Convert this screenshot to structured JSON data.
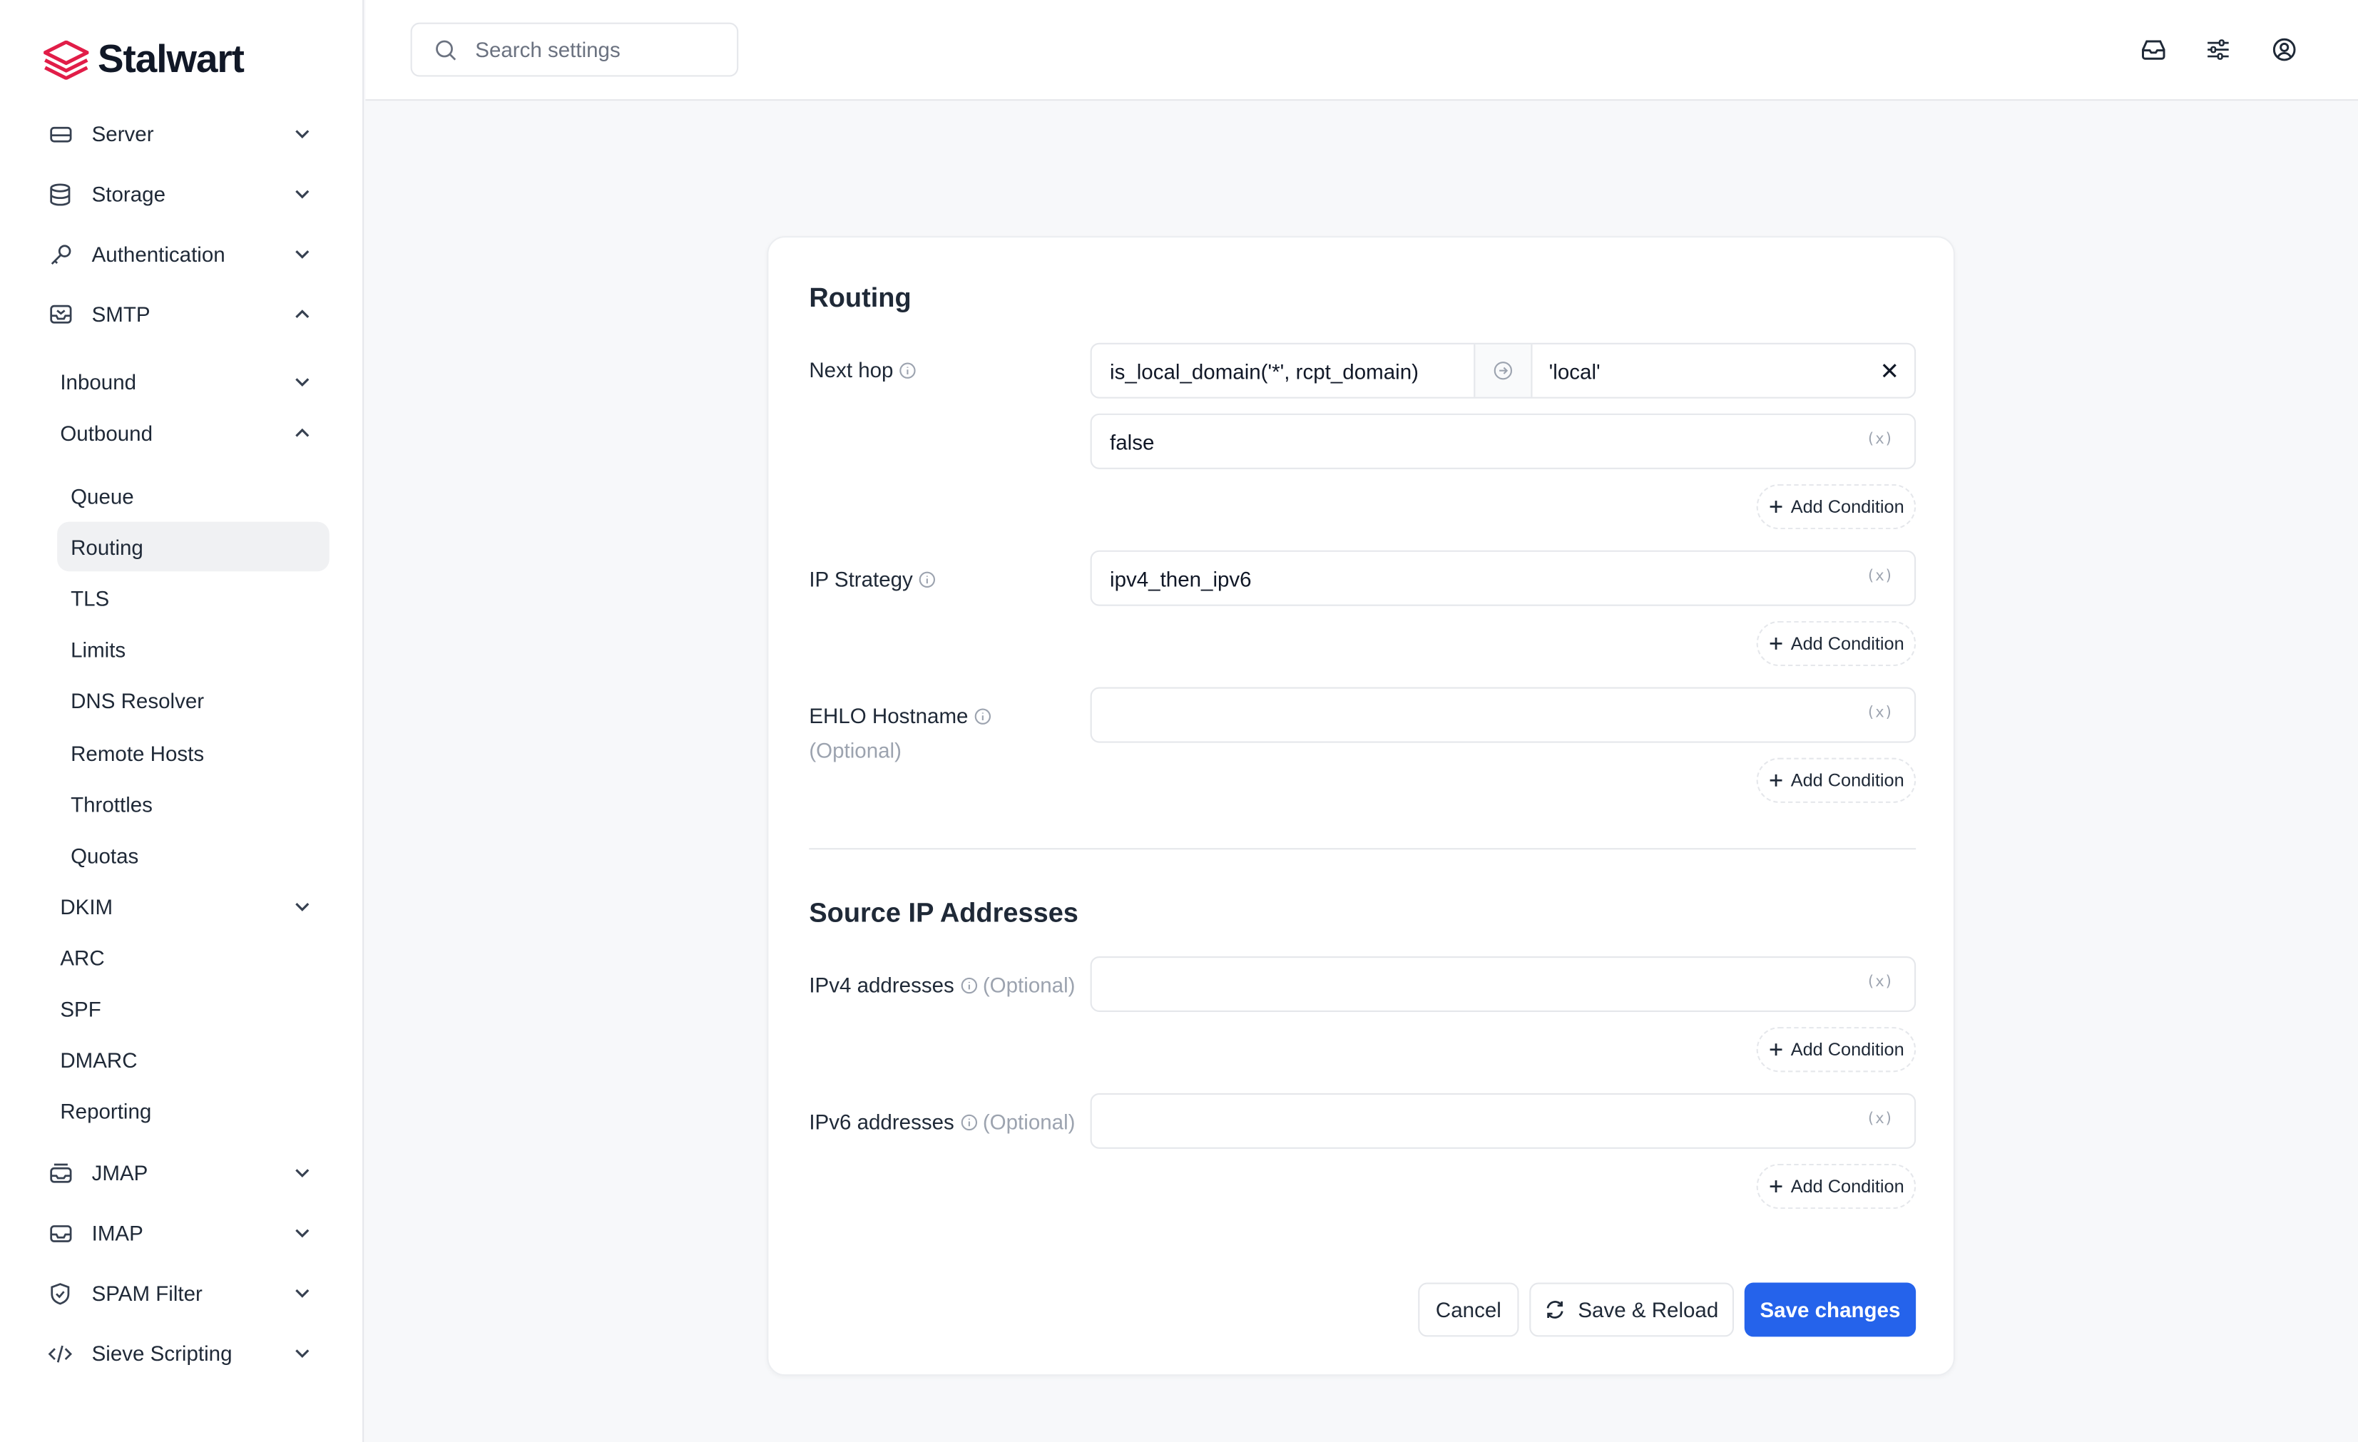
{
  "app": {
    "brand": "Stalwart",
    "brand_color": "#e11d48"
  },
  "search": {
    "placeholder": "Search settings"
  },
  "sidebar": {
    "top": [
      {
        "label": "Server",
        "icon": "server-icon",
        "state": "collapsed"
      },
      {
        "label": "Storage",
        "icon": "database-icon",
        "state": "collapsed"
      },
      {
        "label": "Authentication",
        "icon": "key-icon",
        "state": "collapsed"
      },
      {
        "label": "SMTP",
        "icon": "inbox-icon",
        "state": "expanded"
      },
      {
        "label": "JMAP",
        "icon": "mail-stack-icon",
        "state": "collapsed"
      },
      {
        "label": "IMAP",
        "icon": "inbox-tray-icon",
        "state": "collapsed"
      },
      {
        "label": "SPAM Filter",
        "icon": "shield-icon",
        "state": "collapsed"
      },
      {
        "label": "Sieve Scripting",
        "icon": "code-icon",
        "state": "collapsed"
      }
    ],
    "smtp_sub": [
      {
        "label": "Inbound",
        "state": "collapsed"
      },
      {
        "label": "Outbound",
        "state": "expanded"
      },
      {
        "label": "DKIM",
        "state": "collapsed"
      },
      {
        "label": "ARC"
      },
      {
        "label": "SPF"
      },
      {
        "label": "DMARC"
      },
      {
        "label": "Reporting"
      }
    ],
    "outbound_items": [
      "Queue",
      "Routing",
      "TLS",
      "Limits",
      "DNS Resolver",
      "Remote Hosts",
      "Throttles",
      "Quotas"
    ],
    "active_item": "Routing"
  },
  "topbar_icons": [
    "inbox-tray-icon",
    "sliders-icon",
    "user-circle-icon"
  ],
  "form": {
    "routing_title": "Routing",
    "next_hop": {
      "label": "Next hop",
      "condition_if": "is_local_domain('*', rcpt_domain)",
      "condition_then": "'local'",
      "default": "false",
      "add_label": "Add Condition"
    },
    "ip_strategy": {
      "label": "IP Strategy",
      "value": "ipv4_then_ipv6",
      "add_label": "Add Condition"
    },
    "ehlo": {
      "label": "EHLO Hostname",
      "optional": "(Optional)",
      "value": "",
      "add_label": "Add Condition"
    },
    "source_title": "Source IP Addresses",
    "ipv4": {
      "label": "IPv4 addresses",
      "optional": "(Optional)",
      "value": "",
      "add_label": "Add Condition"
    },
    "ipv6": {
      "label": "IPv6 addresses",
      "optional": "(Optional)",
      "value": "",
      "add_label": "Add Condition"
    },
    "var_marker": "(x)",
    "buttons": {
      "cancel": "Cancel",
      "reload": "Save & Reload",
      "save": "Save changes"
    },
    "accent": "#2563eb"
  }
}
